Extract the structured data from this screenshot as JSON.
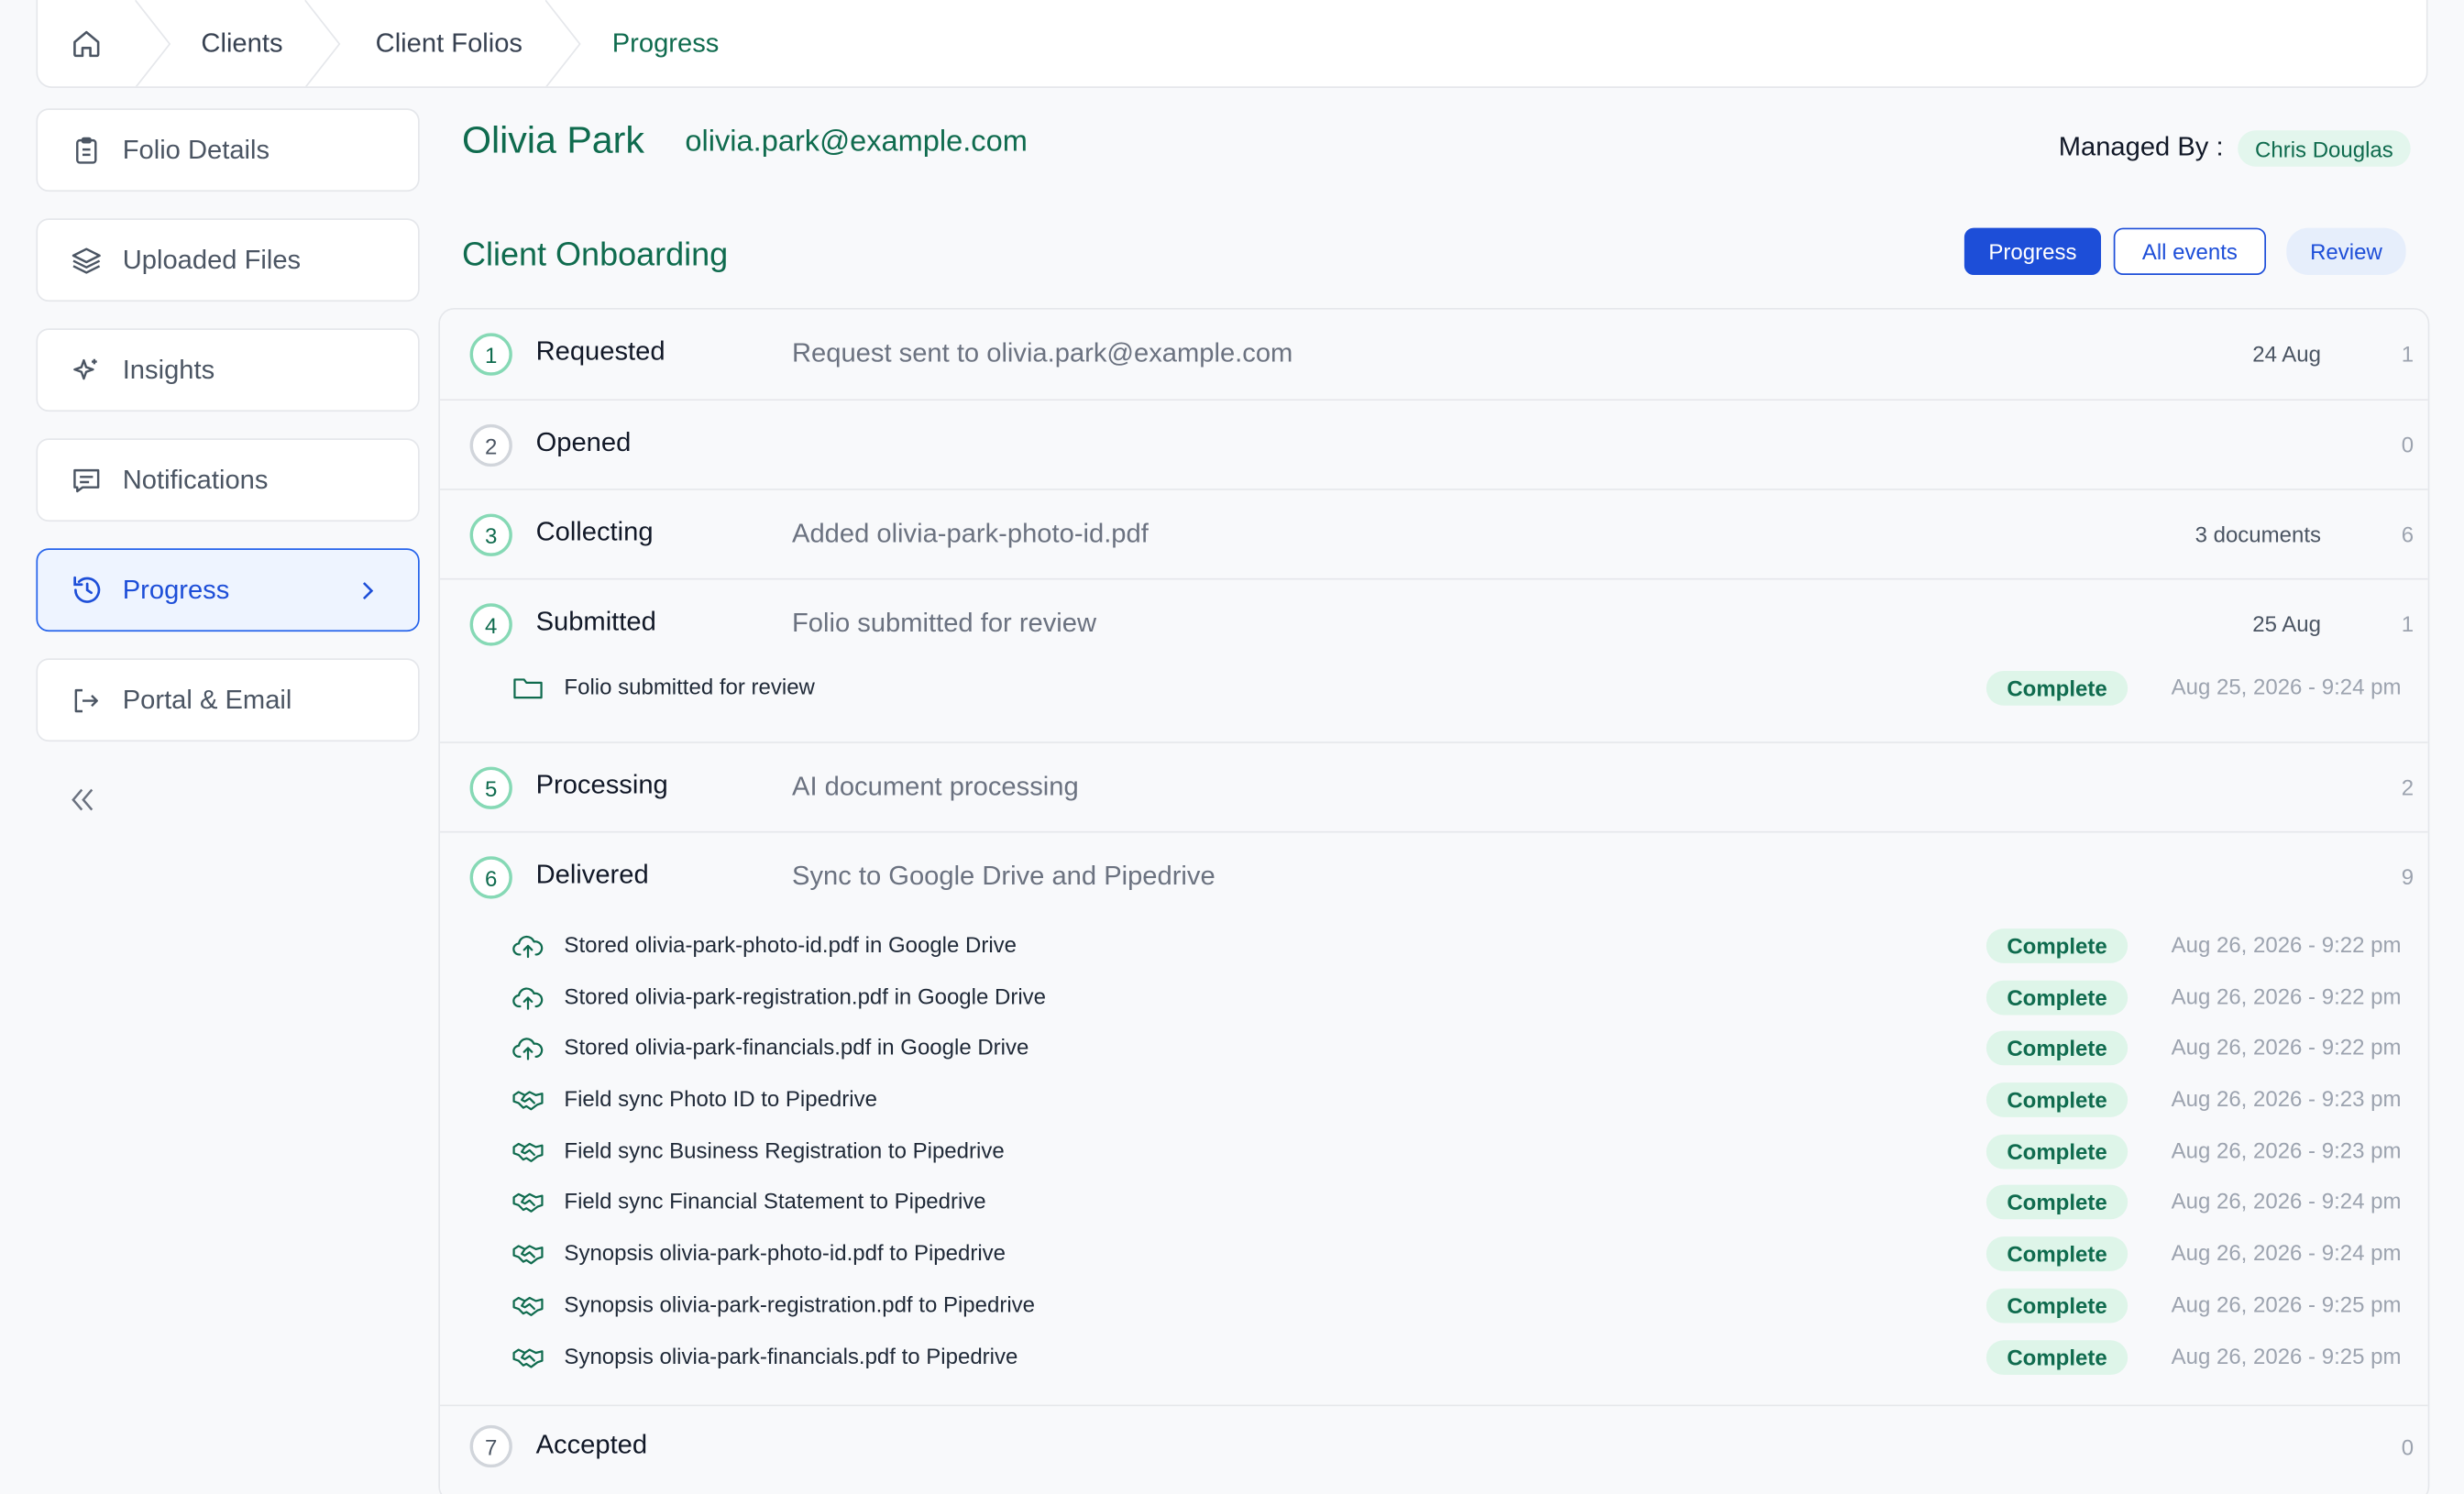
{
  "breadcrumb": {
    "items": [
      "Clients",
      "Client Folios",
      "Progress"
    ]
  },
  "sidebar": {
    "items": [
      {
        "label": "Folio Details",
        "icon": "clipboard-icon"
      },
      {
        "label": "Uploaded Files",
        "icon": "layers-icon"
      },
      {
        "label": "Insights",
        "icon": "sparkle-icon"
      },
      {
        "label": "Notifications",
        "icon": "message-icon"
      },
      {
        "label": "Progress",
        "icon": "history-icon",
        "active": true
      },
      {
        "label": "Portal & Email",
        "icon": "logout-icon"
      }
    ]
  },
  "client": {
    "name": "Olivia Park",
    "email": "olivia.park@example.com",
    "managed_label": "Managed By :",
    "managed_by": "Chris Douglas"
  },
  "section": {
    "title": "Client Onboarding",
    "tabs": [
      "Progress",
      "All events",
      "Review"
    ]
  },
  "steps": [
    {
      "num": "1",
      "label": "Requested",
      "desc": "Request sent to olivia.park@example.com",
      "date": "24 Aug",
      "count": "1"
    },
    {
      "num": "2",
      "label": "Opened",
      "desc": "",
      "date": "",
      "count": "0"
    },
    {
      "num": "3",
      "label": "Collecting",
      "desc": "Added olivia-park-photo-id.pdf",
      "date": "3 documents",
      "count": "6"
    },
    {
      "num": "4",
      "label": "Submitted",
      "desc": "Folio submitted for review",
      "date": "25 Aug",
      "count": "1",
      "events": [
        {
          "text": "Folio submitted for review",
          "status": "Complete",
          "time": "Aug 25, 2026 - 9:24 pm",
          "icon": "folder-icon"
        }
      ]
    },
    {
      "num": "5",
      "label": "Processing",
      "desc": "AI document processing",
      "date": "",
      "count": "2"
    },
    {
      "num": "6",
      "label": "Delivered",
      "desc": "Sync to Google Drive and Pipedrive",
      "date": "",
      "count": "9",
      "events": [
        {
          "text": "Stored olivia-park-photo-id.pdf in Google Drive",
          "status": "Complete",
          "time": "Aug 26, 2026 - 9:22 pm",
          "icon": "cloud-upload-icon"
        },
        {
          "text": "Stored olivia-park-registration.pdf in Google Drive",
          "status": "Complete",
          "time": "Aug 26, 2026 - 9:22 pm",
          "icon": "cloud-upload-icon"
        },
        {
          "text": "Stored olivia-park-financials.pdf in Google Drive",
          "status": "Complete",
          "time": "Aug 26, 2026 - 9:22 pm",
          "icon": "cloud-upload-icon"
        },
        {
          "text": "Field sync Photo ID to Pipedrive",
          "status": "Complete",
          "time": "Aug 26, 2026 - 9:23 pm",
          "icon": "handshake-icon"
        },
        {
          "text": "Field sync Business Registration to Pipedrive",
          "status": "Complete",
          "time": "Aug 26, 2026 - 9:23 pm",
          "icon": "handshake-icon"
        },
        {
          "text": "Field sync Financial Statement to Pipedrive",
          "status": "Complete",
          "time": "Aug 26, 2026 - 9:24 pm",
          "icon": "handshake-icon"
        },
        {
          "text": "Synopsis olivia-park-photo-id.pdf to Pipedrive",
          "status": "Complete",
          "time": "Aug 26, 2026 - 9:24 pm",
          "icon": "handshake-icon"
        },
        {
          "text": "Synopsis olivia-park-registration.pdf to Pipedrive",
          "status": "Complete",
          "time": "Aug 26, 2026 - 9:25 pm",
          "icon": "handshake-icon"
        },
        {
          "text": "Synopsis olivia-park-financials.pdf to Pipedrive",
          "status": "Complete",
          "time": "Aug 26, 2026 - 9:25 pm",
          "icon": "handshake-icon"
        }
      ]
    },
    {
      "num": "7",
      "label": "Accepted",
      "desc": "",
      "date": "",
      "count": "0"
    }
  ],
  "colors": {
    "accent_green": "#0f6b4e",
    "accent_blue": "#1d4ed8",
    "badge_bg": "#def5e9"
  }
}
